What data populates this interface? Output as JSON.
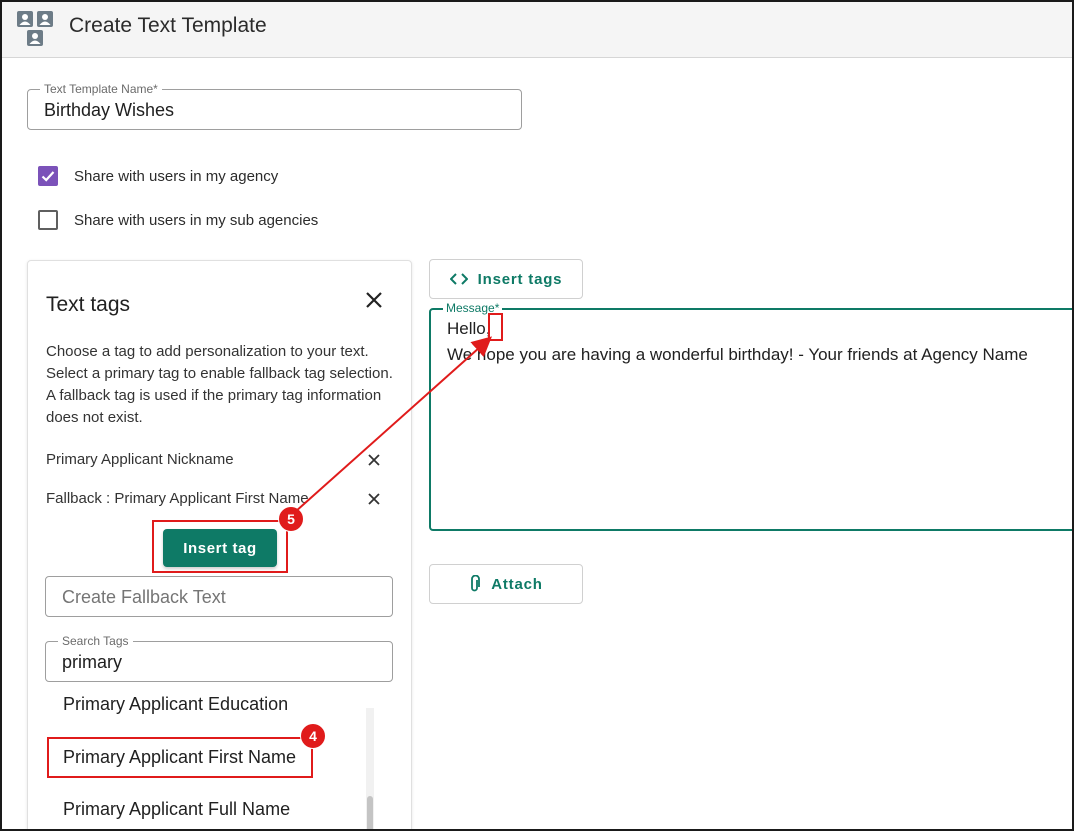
{
  "header": {
    "title": "Create Text Template",
    "icon": "contacts-group-icon"
  },
  "form": {
    "template_name": {
      "label": "Text Template Name*",
      "value": "Birthday Wishes"
    },
    "share_agency": {
      "label": "Share with users in my agency",
      "checked": true
    },
    "share_sub_agencies": {
      "label": "Share with users in my sub agencies",
      "checked": false
    }
  },
  "tags_panel": {
    "title": "Text tags",
    "description": "Choose a tag to add personalization to your text. Select a primary tag to enable fallback tag selection. A fallback tag is used if the primary tag information does not exist.",
    "selected_primary": "Primary Applicant Nickname",
    "selected_fallback": "Fallback : Primary Applicant First Name",
    "insert_button": "Insert tag",
    "fallback_text": {
      "placeholder": "Create Fallback Text"
    },
    "search": {
      "label": "Search Tags",
      "value": "primary"
    },
    "tag_list": [
      "Primary Applicant Education",
      "Primary Applicant First Name",
      "Primary Applicant Full Name"
    ]
  },
  "editor": {
    "insert_tags_button": "Insert tags",
    "message_label": "Message*",
    "message_lines": [
      "Hello,",
      "We hope you are having a wonderful birthday! - Your friends at Agency Name"
    ],
    "attach_button": "Attach"
  },
  "annotations": {
    "step_4": "4",
    "step_5": "5",
    "highlight_color": "#e01b1b"
  },
  "colors": {
    "accent": "#0e7a66",
    "checkbox": "#7b52b9"
  }
}
